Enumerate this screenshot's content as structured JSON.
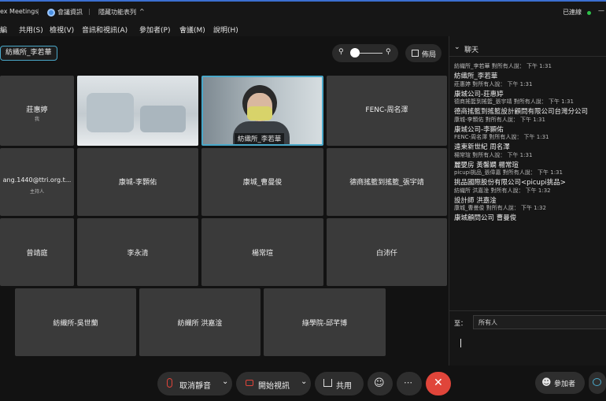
{
  "titlebar": {
    "app_name": "ex Meetings",
    "meeting_info": "會議資訊",
    "hide_menu": "隱藏功能表列",
    "connected": "已連線"
  },
  "menu": [
    "編",
    "共用(S)",
    "檢視(V)",
    "音訊和視訊(A)",
    "參加者(P)",
    "會議(M)",
    "說明(H)"
  ],
  "speaker_tag": "紡織所_李若華",
  "layout_label": "佈局",
  "tiles": [
    {
      "name": "莊惠婷",
      "sub": "我"
    },
    {
      "name": "",
      "sub": ""
    },
    {
      "name": "紡織所_李若華",
      "sub": ""
    },
    {
      "name": "FENC-周名澤",
      "sub": ""
    },
    {
      "name": "ang.1440@ttri.org.t...",
      "sub": "主持人"
    },
    {
      "name": "康城-李顥佑",
      "sub": ""
    },
    {
      "name": "康城_曹曼俊",
      "sub": ""
    },
    {
      "name": "德商搖籃到搖籃_張宇靖",
      "sub": ""
    },
    {
      "name": "曾靖庭",
      "sub": ""
    },
    {
      "name": "李永清",
      "sub": ""
    },
    {
      "name": "楊常瑄",
      "sub": ""
    },
    {
      "name": "白沛仟",
      "sub": ""
    },
    {
      "name": "紡織所-吳世蘭",
      "sub": ""
    },
    {
      "name": "紡織所 洪嘉淦",
      "sub": ""
    },
    {
      "name": "綠學院-邱芊博",
      "sub": ""
    }
  ],
  "controls": {
    "unmute": "取消靜音",
    "start_video": "開始視訊",
    "share": "共用",
    "participants": "參加者"
  },
  "chat": {
    "title": "聊天",
    "to_label": "至：",
    "to_value": "所有人",
    "messages": [
      {
        "meta": "紡織所_李若華 對所有人說：   下午 1:31",
        "text": "紡織所_李若華"
      },
      {
        "meta": "莊惠婷 對所有人說：   下午 1:31",
        "text": "康城公司-莊惠婷"
      },
      {
        "meta": "德商搖籃到搖籃_張宇靖 對所有人說：   下午 1:31",
        "text": "德商搖籃到搖籃設計顧問有限公司台灣分公司"
      },
      {
        "meta": "康城-李顥佑 對所有人說：   下午 1:31",
        "text": "康城公司-李顥佑"
      },
      {
        "meta": "FENC-周名澤 對所有人說：   下午 1:31",
        "text": "遠東新世紀 周名澤"
      },
      {
        "meta": "楊常瑄 對所有人說：   下午 1:31",
        "text": "麗嬰房 黃馨嫻 楊常瑄"
      },
      {
        "meta": "picupi挑品_張偉嘉 對所有人說：   下午 1:31",
        "text": "挑品國際股份有限公司<picupi挑品>"
      },
      {
        "meta": "紡織所 洪嘉淦 對所有人說：   下午 1:32",
        "text": "設計師 洪嘉淦"
      },
      {
        "meta": "康城_曹曼俊 對所有人說：   下午 1:32",
        "text": "康城顧問公司 曹曼俊"
      }
    ]
  },
  "colors": {
    "accent": "#4aa8c9",
    "end_call": "#e0453a",
    "status_green": "#2ec24a"
  }
}
